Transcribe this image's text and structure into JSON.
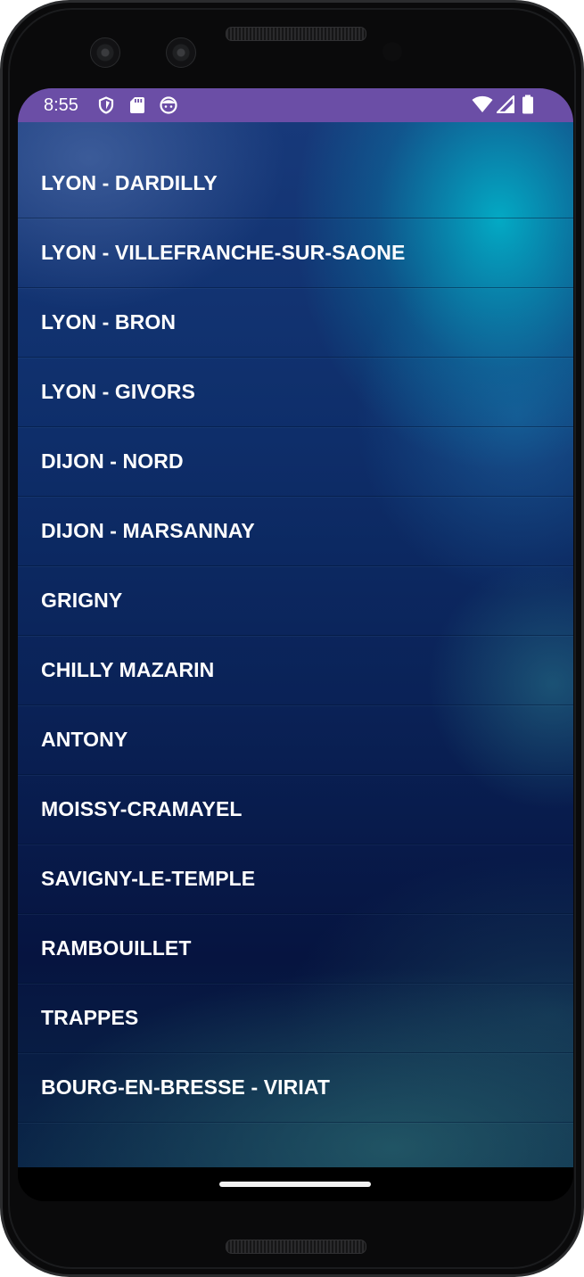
{
  "status_bar": {
    "time": "8:55",
    "left_icons": [
      "shield-icon",
      "sd-card-icon",
      "face-icon"
    ],
    "right_icons": [
      "wifi-icon",
      "cell-signal-icon",
      "battery-icon"
    ],
    "background_color": "#6b4ea6"
  },
  "list": {
    "items": [
      {
        "label": "LYON - DARDILLY"
      },
      {
        "label": "LYON - VILLEFRANCHE-SUR-SAONE"
      },
      {
        "label": "LYON - BRON"
      },
      {
        "label": "LYON - GIVORS"
      },
      {
        "label": "DIJON - NORD"
      },
      {
        "label": "DIJON - MARSANNAY"
      },
      {
        "label": "GRIGNY"
      },
      {
        "label": "CHILLY MAZARIN"
      },
      {
        "label": "ANTONY"
      },
      {
        "label": "MOISSY-CRAMAYEL"
      },
      {
        "label": "SAVIGNY-LE-TEMPLE"
      },
      {
        "label": "RAMBOUILLET"
      },
      {
        "label": "TRAPPES"
      },
      {
        "label": "BOURG-EN-BRESSE - VIRIAT"
      }
    ]
  },
  "nav_bar": {
    "home_indicator": "home-indicator"
  }
}
